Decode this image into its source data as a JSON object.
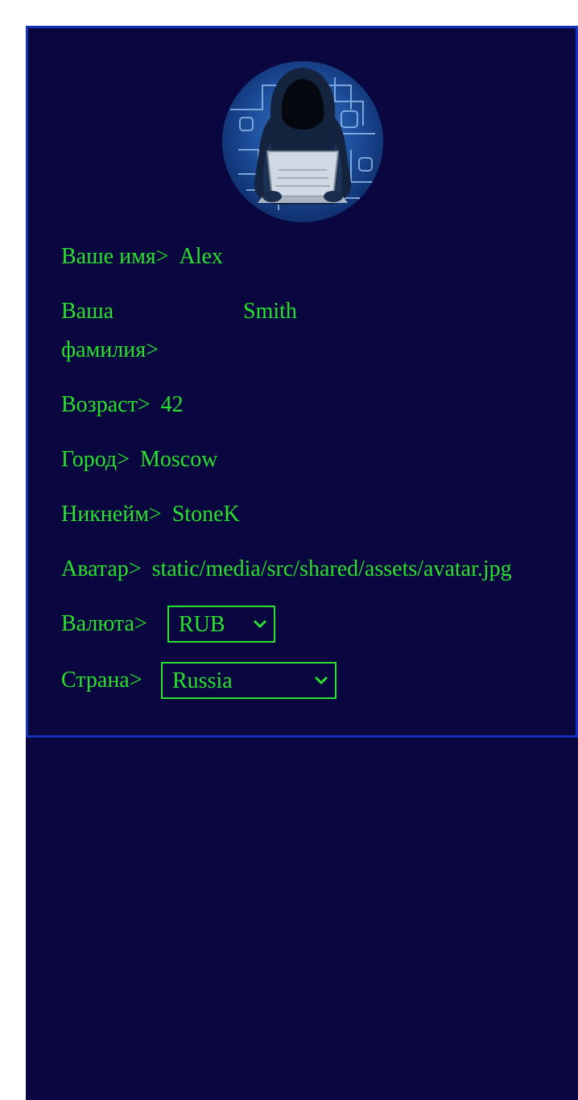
{
  "profile": {
    "first_name_label": "Ваше имя>",
    "first_name_value": "Alex",
    "last_name_label": "Ваша фамилия>",
    "last_name_value": "Smith",
    "age_label": "Возраст>",
    "age_value": "42",
    "city_label": "Город>",
    "city_value": "Moscow",
    "nickname_label": "Никнейм>",
    "nickname_value": "StoneK",
    "avatar_label": "Аватар>",
    "avatar_value": "static/media/src/shared/assets/avatar.jpg",
    "currency_label": "Валюта>",
    "currency_value": "RUB",
    "country_label": "Страна>",
    "country_value": "Russia"
  },
  "colors": {
    "background": "#0a0740",
    "panel_border": "#1233b8",
    "text": "#29e02c"
  },
  "icons": {
    "avatar": "hooded-hacker-avatar",
    "select_arrow": "chevron-down-icon"
  }
}
